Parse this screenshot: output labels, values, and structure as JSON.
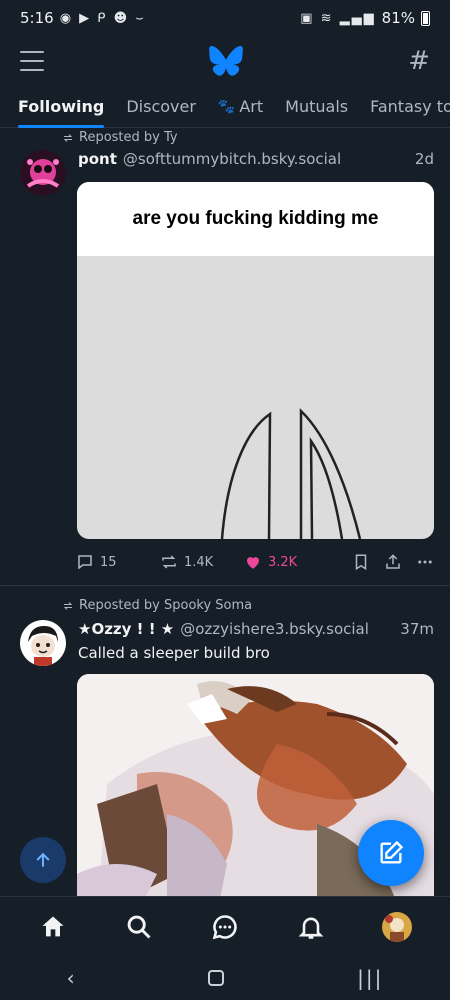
{
  "status_bar": {
    "time": "5:16",
    "battery": "81%"
  },
  "tabs": [
    {
      "label": "Following",
      "active": true
    },
    {
      "label": "Discover",
      "active": false
    },
    {
      "label": "Art",
      "active": false
    },
    {
      "label": "Mutuals",
      "active": false
    },
    {
      "label": "Fantasy toys",
      "active": false
    }
  ],
  "posts": [
    {
      "repost_by": "Reposted by Ty",
      "author": "pont",
      "handle": "@softtummybitch.bsky.social",
      "time": "2d",
      "media_caption": "are you fucking kidding me",
      "replies": "15",
      "reposts": "1.4K",
      "likes": "3.2K"
    },
    {
      "repost_by": "Reposted by Spooky Soma",
      "author": "★Ozzy ! ! ★",
      "handle": "@ozzyishere3.bsky.social",
      "time": "37m",
      "text": "Called a sleeper build bro"
    }
  ],
  "colors": {
    "accent": "#1083fe",
    "like": "#ec4899",
    "bg": "#161e27"
  },
  "icons": {
    "menu": "menu-icon",
    "logo": "butterfly-icon",
    "feeds": "hash-icon",
    "reply": "reply-icon",
    "repost": "repost-icon",
    "like": "heart-icon",
    "bookmark": "bookmark-icon",
    "share": "share-icon",
    "more": "more-icon"
  },
  "nav": [
    "home-icon",
    "search-icon",
    "chat-icon",
    "bell-icon",
    "profile-avatar"
  ]
}
